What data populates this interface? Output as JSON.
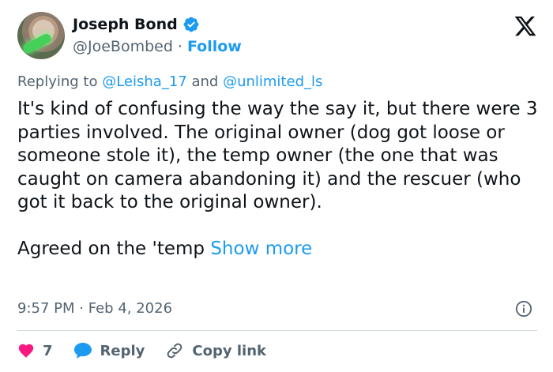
{
  "author": {
    "name": "Joseph Bond",
    "handle": "@JoeBombed",
    "separator": "·",
    "follow_label": "Follow"
  },
  "reply_context": {
    "prefix": "Replying to",
    "mentions": [
      "@Leisha_17",
      "@unlimited_ls"
    ],
    "joiner": "and"
  },
  "tweet": {
    "paragraph1": "It's kind of confusing the way the say it, but there were 3 parties involved. The original owner (dog got loose or someone stole it), the temp owner (the one that was caught on camera abandoning it) and the rescuer (who got it back to the original owner).",
    "paragraph2": "Agreed on the 'temp",
    "show_more": "Show more"
  },
  "meta": {
    "time": "9:57 PM",
    "separator": "·",
    "date": "Feb 4, 2026"
  },
  "actions": {
    "like_count": "7",
    "reply_label": "Reply",
    "copy_link_label": "Copy link"
  },
  "icons": {
    "verified": "verified-badge-icon",
    "brand": "x-logo-icon",
    "info": "info-icon",
    "like": "heart-icon",
    "reply": "reply-bubble-icon",
    "copy": "link-icon"
  },
  "colors": {
    "accent": "#1d9bf0",
    "like": "#f91880",
    "text": "#0f1419",
    "muted": "#536471"
  }
}
